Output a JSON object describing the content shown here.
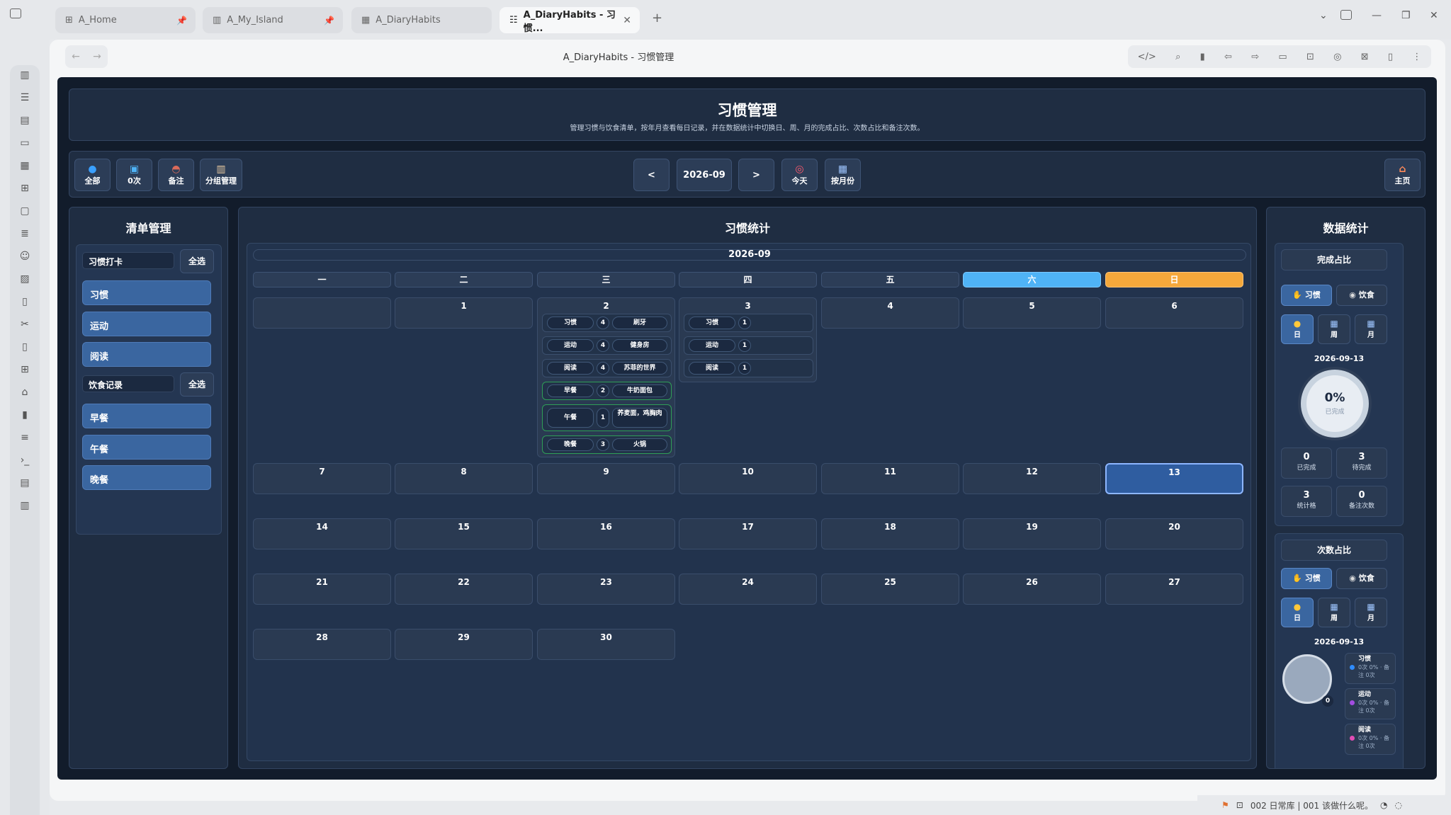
{
  "tabs": [
    {
      "label": "A_Home",
      "icon": "grid-icon"
    },
    {
      "label": "A_My_Island",
      "icon": "book-icon"
    },
    {
      "label": "A_DiaryHabits",
      "icon": "calendar-icon"
    },
    {
      "label": "A_DiaryHabits - 习惯...",
      "icon": "list-icon"
    }
  ],
  "doc_title": "A_DiaryHabits - 习惯管理",
  "header": {
    "title": "习惯管理",
    "subtitle": "管理习惯与饮食清单，按年月查看每日记录，并在数据统计中切换日、周、月的完成占比、次数占比和备注次数。"
  },
  "toolbar": {
    "all": "全部",
    "zero": "0次",
    "note": "备注",
    "group": "分组管理",
    "prev": "<",
    "month": "2026-09",
    "next": ">",
    "today": "今天",
    "by_month": "按月份",
    "home": "主页"
  },
  "list_panel": {
    "title": "清单管理",
    "group1": {
      "label": "习惯打卡",
      "all": "全选",
      "items": [
        "习惯",
        "运动",
        "阅读"
      ]
    },
    "group2": {
      "label": "饮食记录",
      "all": "全选",
      "items": [
        "早餐",
        "午餐",
        "晚餐"
      ]
    }
  },
  "calendar": {
    "title": "习惯统计",
    "month": "2026-09",
    "weekdays": [
      "一",
      "二",
      "三",
      "四",
      "五",
      "六",
      "日"
    ],
    "days": [
      "1",
      "2",
      "3",
      "4",
      "5",
      "6",
      "7",
      "8",
      "9",
      "10",
      "11",
      "12",
      "13",
      "14",
      "15",
      "16",
      "17",
      "18",
      "19",
      "20",
      "21",
      "22",
      "23",
      "24",
      "25",
      "26",
      "27",
      "28",
      "29",
      "30"
    ],
    "day2": [
      {
        "name": "习惯",
        "count": "4",
        "note": "刷牙",
        "kind": "habit"
      },
      {
        "name": "运动",
        "count": "4",
        "note": "健身房",
        "kind": "habit"
      },
      {
        "name": "阅读",
        "count": "4",
        "note": "苏菲的世界",
        "kind": "habit"
      },
      {
        "name": "早餐",
        "count": "2",
        "note": "牛奶面包",
        "kind": "food"
      },
      {
        "name": "午餐",
        "count": "1",
        "note": "荞麦面，鸡胸肉",
        "kind": "food"
      },
      {
        "name": "晚餐",
        "count": "3",
        "note": "火锅",
        "kind": "food"
      }
    ],
    "day3": [
      {
        "name": "习惯",
        "count": "1"
      },
      {
        "name": "运动",
        "count": "1"
      },
      {
        "name": "阅读",
        "count": "1"
      }
    ]
  },
  "stats": {
    "title": "数据统计",
    "completion": {
      "title": "完成占比",
      "seg_habit": "习惯",
      "seg_food": "饮食",
      "periods": [
        "日",
        "周",
        "月"
      ],
      "date": "2026-09-13",
      "percent": "0%",
      "percent_label": "已完成",
      "kpis": [
        {
          "value": "0",
          "label": "已完成"
        },
        {
          "value": "3",
          "label": "待完成"
        },
        {
          "value": "3",
          "label": "统计格"
        },
        {
          "value": "0",
          "label": "备注次数"
        }
      ]
    },
    "count": {
      "title": "次数占比",
      "seg_habit": "习惯",
      "seg_food": "饮食",
      "periods": [
        "日",
        "周",
        "月"
      ],
      "date": "2026-09-13",
      "total": "0",
      "legend": [
        {
          "name": "习惯",
          "detail": "0次 0% · 备注 0次",
          "color": "#2f8cff"
        },
        {
          "name": "运动",
          "detail": "0次 0% · 备注 0次",
          "color": "#a24de0"
        },
        {
          "name": "阅读",
          "detail": "0次 0% · 备注 0次",
          "color": "#e04db5"
        }
      ]
    }
  },
  "statusbar": {
    "text": "002 日常库 | 001 该做什么呢。"
  }
}
